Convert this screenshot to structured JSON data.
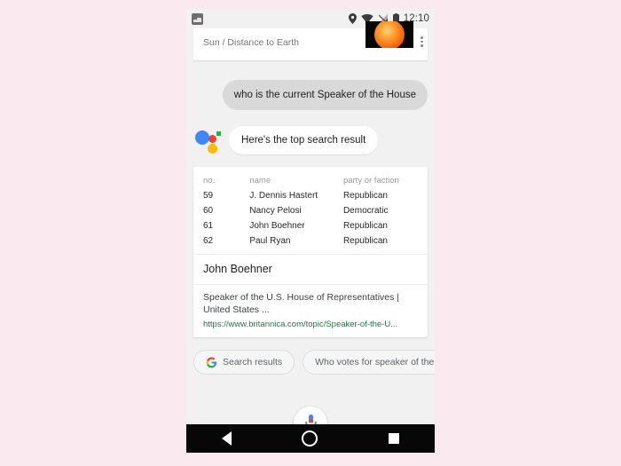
{
  "statusbar": {
    "notification_icon": "photo-icon",
    "icons": [
      "location-pin-icon",
      "wifi-icon",
      "cell-signal-icon",
      "battery-icon"
    ],
    "time": "12:10"
  },
  "topcard": {
    "title": "Sun / Distance to Earth",
    "thumbnail": "sun-image",
    "overflow_icon": "kebab-menu-icon"
  },
  "conversation": {
    "query": "who is the current Speaker of the House",
    "assistant_logo": "google-assistant-logo",
    "reply": "Here's the top search result"
  },
  "knowledge_card": {
    "table": {
      "headers": [
        "no.",
        "name",
        "party or faction"
      ],
      "rows": [
        [
          "59",
          "J. Dennis Hastert",
          "Republican"
        ],
        [
          "60",
          "Nancy Pelosi",
          "Democratic"
        ],
        [
          "61",
          "John Boehner",
          "Republican"
        ],
        [
          "62",
          "Paul Ryan",
          "Republican"
        ]
      ]
    },
    "title": "John Boehner",
    "snippet": "Speaker of the U.S. House of Representatives | United States ...",
    "url": "https://www.britannica.com/topic/Speaker-of-the-U..."
  },
  "chips": {
    "search_results": {
      "icon": "google-g-icon",
      "label": "Search results"
    },
    "suggestion": {
      "label": "Who votes for speaker of the House"
    }
  },
  "mic": {
    "icon": "google-mic-icon"
  },
  "navbar": {
    "back": "back-triangle-icon",
    "home": "home-circle-icon",
    "recents": "recents-square-icon"
  },
  "colors": {
    "page_background": "#faeaef",
    "app_background": "#f1f1f1",
    "query_bubble": "#d9d9d9",
    "card": "#ffffff",
    "url_green": "#1a7a3c",
    "google_blue": "#4285f4",
    "google_red": "#ea4335",
    "google_yellow": "#fbbc05",
    "google_green": "#34a853",
    "navbar": "#070707"
  }
}
